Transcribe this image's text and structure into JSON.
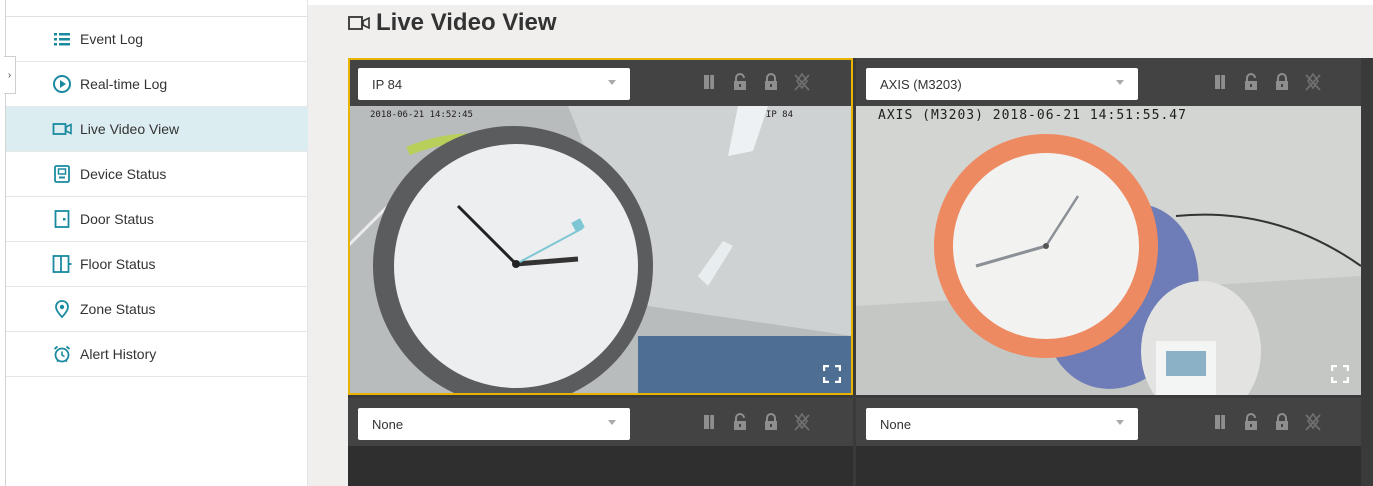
{
  "sidebar": {
    "items": [
      {
        "label": "Event Log",
        "icon": "list-icon",
        "active": false
      },
      {
        "label": "Real-time Log",
        "icon": "play-circle-icon",
        "active": false
      },
      {
        "label": "Live Video View",
        "icon": "video-camera-icon",
        "active": true
      },
      {
        "label": "Device Status",
        "icon": "device-icon",
        "active": false
      },
      {
        "label": "Door Status",
        "icon": "door-icon",
        "active": false
      },
      {
        "label": "Floor Status",
        "icon": "floor-icon",
        "active": false
      },
      {
        "label": "Zone Status",
        "icon": "location-pin-icon",
        "active": false
      },
      {
        "label": "Alert History",
        "icon": "alarm-clock-icon",
        "active": false
      }
    ]
  },
  "main": {
    "title": "Live Video View",
    "title_icon": "video-camera-icon",
    "cells": [
      {
        "camera": "IP 84",
        "osd_timestamp": "2018-06-21 14:52:45",
        "osd_label": "IP 84",
        "selected": true,
        "feed": "wall-clock-gray"
      },
      {
        "camera": "AXIS (M3203)",
        "osd_timestamp": "AXIS (M3203) 2018-06-21 14:51:55.47",
        "selected": false,
        "feed": "wall-clock-orange"
      },
      {
        "camera": "None",
        "selected": false,
        "feed": "empty"
      },
      {
        "camera": "None",
        "selected": false,
        "feed": "empty"
      }
    ]
  },
  "colors": {
    "accent_selected": "#e8b400",
    "active_nav_bg": "#dcedf1",
    "icon_teal": "#1a8aa0"
  }
}
